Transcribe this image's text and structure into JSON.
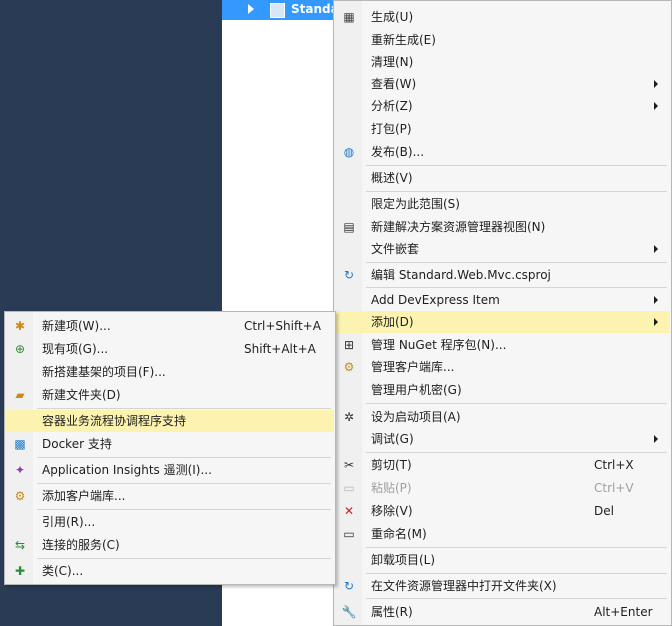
{
  "explorer": {
    "project_label": "Standa"
  },
  "main_menu": {
    "items": [
      {
        "label": "生成(U)"
      },
      {
        "label": "重新生成(E)"
      },
      {
        "label": "清理(N)"
      },
      {
        "label": "查看(W)"
      },
      {
        "label": "分析(Z)"
      },
      {
        "label": "打包(P)"
      },
      {
        "label": "发布(B)..."
      },
      {
        "label": "概述(V)"
      },
      {
        "label": "限定为此范围(S)"
      },
      {
        "label": "新建解决方案资源管理器视图(N)"
      },
      {
        "label": "文件嵌套"
      },
      {
        "label": "编辑 Standard.Web.Mvc.csproj"
      },
      {
        "label": "Add DevExpress Item"
      },
      {
        "label": "添加(D)"
      },
      {
        "label": "管理 NuGet 程序包(N)..."
      },
      {
        "label": "管理客户端库..."
      },
      {
        "label": "管理用户机密(G)"
      },
      {
        "label": "设为启动项目(A)"
      },
      {
        "label": "调试(G)"
      },
      {
        "label": "剪切(T)",
        "shortcut": "Ctrl+X"
      },
      {
        "label": "粘贴(P)",
        "shortcut": "Ctrl+V"
      },
      {
        "label": "移除(V)",
        "shortcut": "Del"
      },
      {
        "label": "重命名(M)"
      },
      {
        "label": "卸载项目(L)"
      },
      {
        "label": "在文件资源管理器中打开文件夹(X)"
      },
      {
        "label": "属性(R)",
        "shortcut": "Alt+Enter"
      }
    ]
  },
  "sub_menu": {
    "items": [
      {
        "label": "新建项(W)...",
        "shortcut": "Ctrl+Shift+A"
      },
      {
        "label": "现有项(G)...",
        "shortcut": "Shift+Alt+A"
      },
      {
        "label": "新搭建基架的项目(F)..."
      },
      {
        "label": "新建文件夹(D)"
      },
      {
        "label": "容器业务流程协调程序支持"
      },
      {
        "label": "Docker 支持"
      },
      {
        "label": "Application Insights 遥测(I)..."
      },
      {
        "label": "添加客户端库..."
      },
      {
        "label": "引用(R)..."
      },
      {
        "label": "连接的服务(C)"
      },
      {
        "label": "类(C)..."
      }
    ]
  },
  "colors": {
    "highlight": "#fcf3b0",
    "menu_bg": "#f6f6f6",
    "selection": "#3399ff",
    "ide_dark": "#293b55"
  },
  "icons": [
    "build-icon",
    "publish-icon",
    "solution-view-icon",
    "edit-icon",
    "nuget-icon",
    "client-library-icon",
    "settings-icon",
    "cut-icon",
    "paste-icon",
    "remove-icon",
    "rename-icon",
    "open-folder-icon",
    "properties-icon",
    "new-item-icon",
    "existing-item-icon",
    "new-folder-icon",
    "docker-icon",
    "insights-icon",
    "connected-services-icon",
    "class-icon"
  ]
}
